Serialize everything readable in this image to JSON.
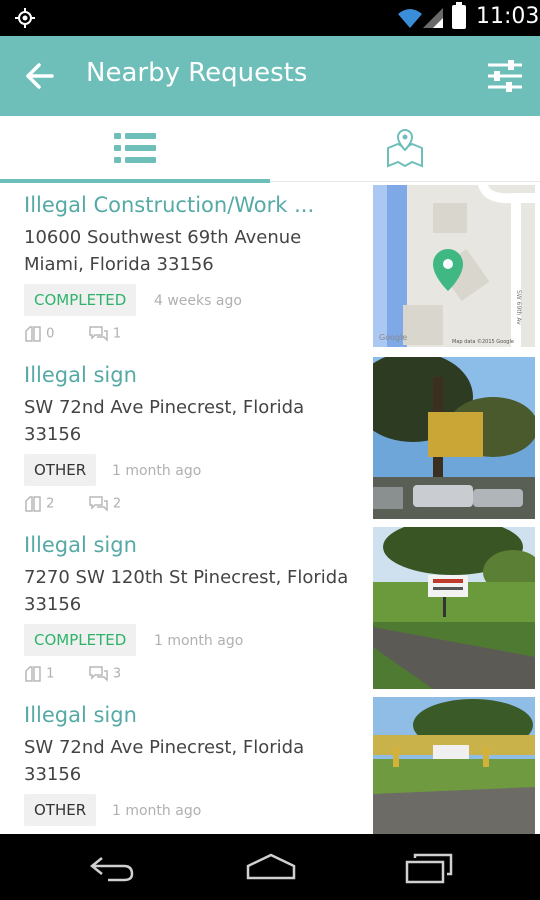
{
  "status_bar": {
    "time": "11:03"
  },
  "app_bar": {
    "title": "Nearby Requests"
  },
  "requests": [
    {
      "title": "Illegal Construction/Work ...",
      "address": "10600  Southwest 69th Avenue Miami, Florida 33156",
      "status": "COMPLETED",
      "age": "4 weeks ago",
      "votes": "0",
      "comments": "1",
      "map_attribution": "Map data ©2015 Google",
      "map_logo": "Google",
      "map_road": "SW 69th Av"
    },
    {
      "title": "Illegal sign",
      "address": "SW 72nd Ave Pinecrest, Florida 33156",
      "status": "OTHER",
      "age": "1 month ago",
      "votes": "2",
      "comments": "2"
    },
    {
      "title": "Illegal sign",
      "address": "7270  SW 120th St Pinecrest, Florida 33156",
      "status": "COMPLETED",
      "age": "1 month ago",
      "votes": "1",
      "comments": "3"
    },
    {
      "title": "Illegal sign",
      "address": "SW 72nd Ave Pinecrest, Florida 33156",
      "status": "OTHER",
      "age": "1 month ago",
      "votes": "",
      "comments": ""
    }
  ],
  "colors": {
    "accent": "#6ebfba",
    "title_text": "#56aaa6",
    "completed": "#2fb36b",
    "map_marker": "#3fb883"
  }
}
